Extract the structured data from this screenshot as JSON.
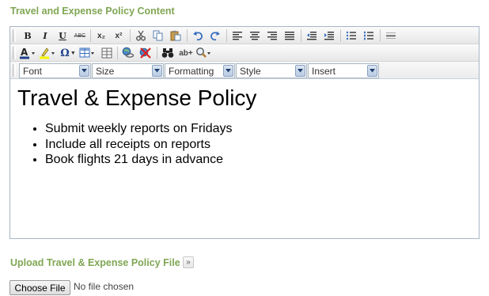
{
  "section_title": "Travel and Expense Policy Content",
  "toolbar_row1": [
    {
      "name": "bold-button",
      "label": "B"
    },
    {
      "name": "italic-button",
      "label": "I"
    },
    {
      "name": "underline-button",
      "label": "U"
    },
    {
      "name": "strikethrough-button",
      "label": "ABC"
    },
    {
      "name": "subscript-button",
      "label": "x₂"
    },
    {
      "name": "superscript-button",
      "label": "x²"
    },
    {
      "name": "cut-button",
      "icon": "scissors-icon"
    },
    {
      "name": "copy-button",
      "icon": "copy-icon"
    },
    {
      "name": "paste-button",
      "icon": "paste-icon"
    },
    {
      "name": "undo-button",
      "icon": "undo-icon"
    },
    {
      "name": "redo-button",
      "icon": "redo-icon"
    },
    {
      "name": "align-left-button",
      "icon": "align-left-icon"
    },
    {
      "name": "align-center-button",
      "icon": "align-center-icon"
    },
    {
      "name": "align-right-button",
      "icon": "align-right-icon"
    },
    {
      "name": "justify-button",
      "icon": "justify-icon"
    },
    {
      "name": "outdent-button",
      "icon": "outdent-icon"
    },
    {
      "name": "indent-button",
      "icon": "indent-icon"
    },
    {
      "name": "bulleted-list-button",
      "icon": "bullet-list-icon"
    },
    {
      "name": "numbered-list-button",
      "icon": "numbered-list-icon"
    },
    {
      "name": "horizontal-rule-button",
      "icon": "horizontal-rule-icon"
    }
  ],
  "toolbar_row2": [
    {
      "name": "font-color-button",
      "icon": "font-color-icon"
    },
    {
      "name": "highlight-color-button",
      "icon": "highlight-icon"
    },
    {
      "name": "special-character-button",
      "label": "Ω"
    },
    {
      "name": "insert-table-button",
      "icon": "table-icon"
    },
    {
      "name": "table-properties-button",
      "icon": "table-properties-icon"
    },
    {
      "name": "insert-link-button",
      "icon": "link-icon"
    },
    {
      "name": "remove-link-button",
      "icon": "unlink-icon"
    },
    {
      "name": "find-button",
      "icon": "binoculars-icon"
    },
    {
      "name": "replace-button",
      "label": "ab+"
    },
    {
      "name": "zoom-button",
      "icon": "magnifier-icon"
    }
  ],
  "dropdowns": {
    "font": "Font",
    "size": "Size",
    "formatting": "Formatting",
    "style": "Style",
    "insert": "Insert"
  },
  "content": {
    "heading": "Travel & Expense Policy",
    "bullets": [
      "Submit weekly reports on Fridays",
      "Include all receipts on reports",
      "Book flights 21 days in advance"
    ]
  },
  "upload": {
    "title": "Upload Travel & Expense Policy File",
    "expand_label": "»",
    "choose_button": "Choose File",
    "status": "No file chosen"
  },
  "colors": {
    "title_green": "#7fa653",
    "border_blue": "#a8b6c4"
  }
}
